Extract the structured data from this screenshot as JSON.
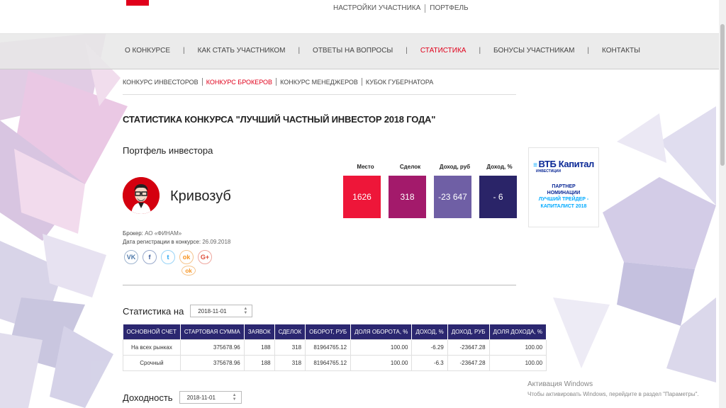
{
  "top_nav": {
    "participant_settings": "НАСТРОЙКИ УЧАСТНИКА",
    "portfolio": "ПОРТФЕЛЬ"
  },
  "main_nav": {
    "items": [
      {
        "label": "О КОНКУРСЕ",
        "active": false
      },
      {
        "label": "КАК СТАТЬ УЧАСТНИКОМ",
        "active": false
      },
      {
        "label": "ОТВЕТЫ НА ВОПРОСЫ",
        "active": false
      },
      {
        "label": "СТАТИСТИКА",
        "active": true
      },
      {
        "label": "БОНУСЫ УЧАСТНИКАМ",
        "active": false
      },
      {
        "label": "КОНТАКТЫ",
        "active": false
      }
    ],
    "separator": "|"
  },
  "sub_nav": {
    "items": [
      {
        "label": "КОНКУРС ИНВЕСТОРОВ",
        "active": false
      },
      {
        "label": "КОНКУРС БРОКЕРОВ",
        "active": true
      },
      {
        "label": "КОНКУРС МЕНЕДЖЕРОВ",
        "active": false
      },
      {
        "label": "КУБОК ГУБЕРНАТОРА",
        "active": false
      }
    ]
  },
  "page_title": "СТАТИСТИКА КОНКУРСА \"ЛУЧШИЙ ЧАСТНЫЙ ИНВЕСТОР 2018 ГОДА\"",
  "portfolio_title": "Портфель инвестора",
  "investor": {
    "name": "Кривозуб",
    "broker_label": "Брокер:",
    "broker_value": "АО «ФИНАМ»",
    "reg_label": "Дата регистрации в конкурсе:",
    "reg_value": "26.09.2018"
  },
  "socials": {
    "vk": "VK",
    "fb": "f",
    "tw": "t",
    "ok": "ok",
    "gp": "G+",
    "ok2": "ok"
  },
  "summary": {
    "labels": {
      "place": "Место",
      "deals": "Сделок",
      "income_rub": "Доход, руб",
      "income_pct": "Доход, %"
    },
    "values": {
      "place": "1626",
      "deals": "318",
      "income_rub": "-23 647",
      "income_pct": "- 6"
    },
    "colors": {
      "place": "#ee1639",
      "deals": "#a31a6b",
      "income_rub": "#6f5fa5",
      "income_pct": "#2a2468"
    }
  },
  "stats_section": {
    "title": "Статистика на",
    "date": "2018-11-01"
  },
  "table": {
    "headers": [
      "ОСНОВНОЙ СЧЕТ",
      "СТАРТОВАЯ СУММА",
      "ЗАЯВОК",
      "СДЕЛОК",
      "ОБОРОТ, РУБ",
      "ДОЛЯ ОБОРОТА, %",
      "ДОХОД, %",
      "ДОХОД, РУБ",
      "ДОЛЯ ДОХОДА, %"
    ],
    "rows": [
      [
        "На всех рынках",
        "375678.96",
        "188",
        "318",
        "81964765.12",
        "100.00",
        "-6.29",
        "-23647.28",
        "100.00"
      ],
      [
        "Срочный",
        "375678.96",
        "188",
        "318",
        "81964765.12",
        "100.00",
        "-6.3",
        "-23647.28",
        "100.00"
      ]
    ]
  },
  "income_section": {
    "title": "Доходность",
    "date": "2018-11-01"
  },
  "banner": {
    "brand": "ВТБ Капитал",
    "brand_sub": "ИНВЕСТИЦИИ",
    "partner_line1": "ПАРТНЕР",
    "partner_line2": "НОМИНАЦИИ",
    "nomination_line1": "ЛУЧШИЙ ТРЕЙДЕР -",
    "nomination_line2": "КАПИТАЛИСТ 2018"
  },
  "windows_activation": {
    "title": "Активация Windows",
    "text": "Чтобы активировать Windows, перейдите в раздел \"Параметры\"."
  },
  "accent_color": "#e0001b",
  "table_header_color": "#2b2770"
}
